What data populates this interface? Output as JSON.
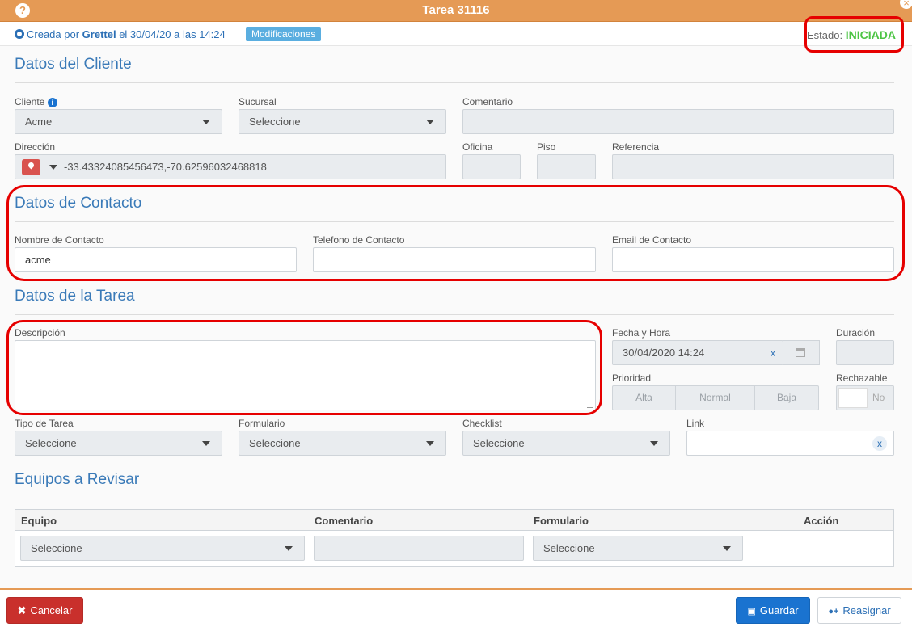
{
  "header": {
    "title": "Tarea 31116",
    "help_icon": "?",
    "close_icon": "×"
  },
  "info": {
    "created_prefix": "Creada por",
    "created_by": "Grettel",
    "created_suffix": "el 30/04/20 a las 14:24",
    "modifications_label": "Modificaciones",
    "status_label": "Estado:",
    "status_value": "INICIADA",
    "status_color": "#4cc443"
  },
  "client": {
    "section_title": "Datos del Cliente",
    "client_label": "Cliente",
    "client_value": "Acme",
    "branch_label": "Sucursal",
    "branch_value": "Seleccione",
    "comment_label": "Comentario",
    "address_label": "Dirección",
    "address_value": "-33.43324085456473,-70.62596032468818",
    "office_label": "Oficina",
    "floor_label": "Piso",
    "reference_label": "Referencia"
  },
  "contact": {
    "section_title": "Datos de Contacto",
    "name_label": "Nombre de Contacto",
    "name_value": "acme",
    "phone_label": "Telefono de Contacto",
    "phone_value": "",
    "email_label": "Email de Contacto",
    "email_value": ""
  },
  "task": {
    "section_title": "Datos de la Tarea",
    "description_label": "Descripción",
    "description_value": "",
    "datetime_label": "Fecha y Hora",
    "datetime_value": "30/04/2020 14:24",
    "datetime_clear": "x",
    "duration_label": "Duración",
    "priority_label": "Prioridad",
    "priority_options": [
      "Alta",
      "Normal",
      "Baja"
    ],
    "rejectable_label": "Rechazable",
    "rejectable_value": "No",
    "type_label": "Tipo de Tarea",
    "type_value": "Seleccione",
    "form_label": "Formulario",
    "form_value": "Seleccione",
    "checklist_label": "Checklist",
    "checklist_value": "Seleccione",
    "link_label": "Link",
    "link_clear": "x"
  },
  "equipment": {
    "section_title": "Equipos a Revisar",
    "columns": [
      "Equipo",
      "Comentario",
      "Formulario",
      "Acción"
    ],
    "row": {
      "equipment_value": "Seleccione",
      "comment_value": "",
      "form_value": "Seleccione"
    }
  },
  "footer": {
    "cancel_label": "Cancelar",
    "cancel_icon": "✖",
    "save_label": "Guardar",
    "save_icon": "💾",
    "reassign_label": "Reasignar",
    "reassign_icon": "👤"
  },
  "colors": {
    "header": "#e59a55",
    "accent": "#3a7ab8",
    "highlight": "#e60000",
    "cancel": "#c9302c",
    "save": "#1a73d0"
  }
}
